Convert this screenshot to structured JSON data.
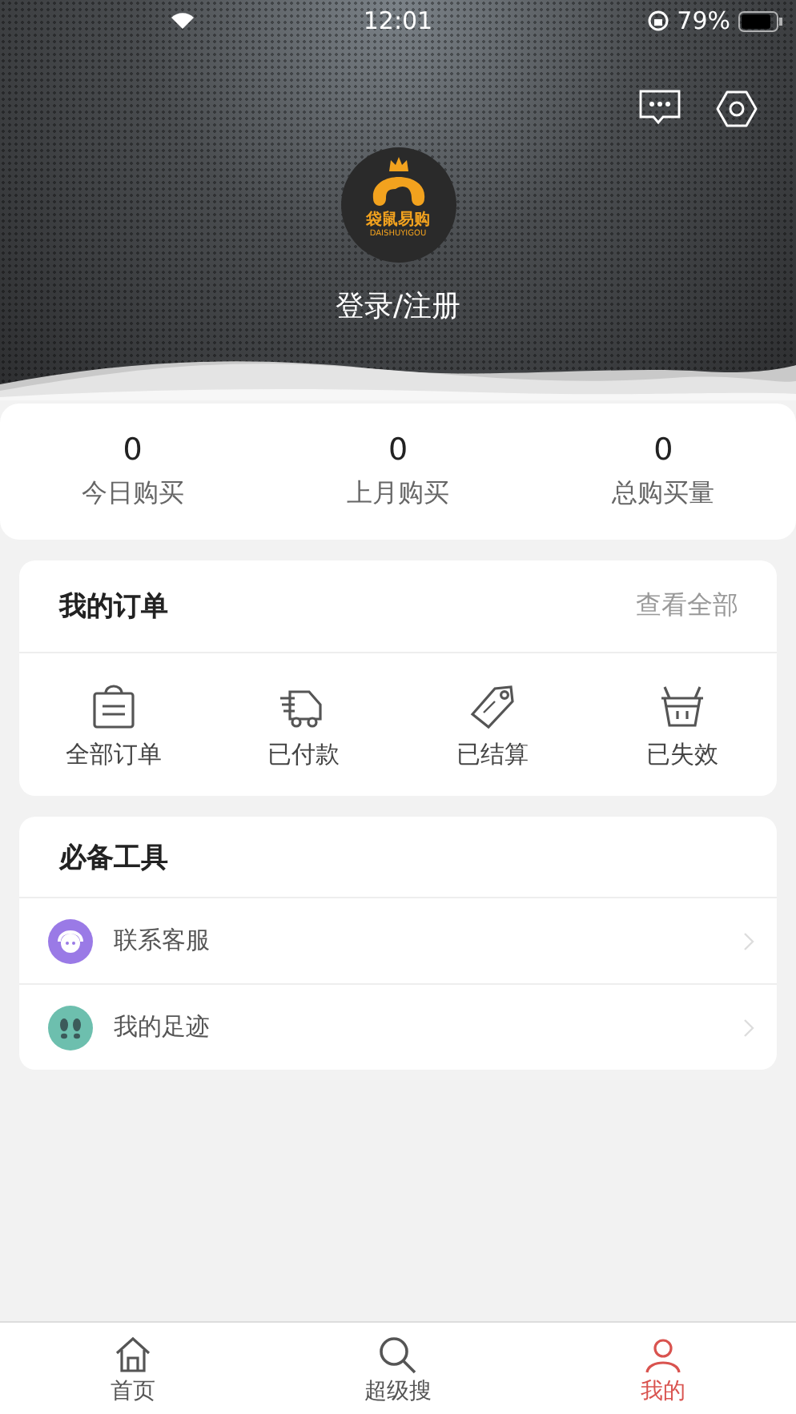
{
  "status_bar": {
    "time": "12:01",
    "battery": "79%"
  },
  "header": {
    "logo": {
      "name": "袋鼠易购",
      "subtitle": "DAISHUYIGOU"
    },
    "login": "登录/注册"
  },
  "stats": [
    {
      "value": "0",
      "label": "今日购买"
    },
    {
      "value": "0",
      "label": "上月购买"
    },
    {
      "value": "0",
      "label": "总购买量"
    }
  ],
  "orders": {
    "title": "我的订单",
    "view_all": "查看全部",
    "items": [
      {
        "kind": "bag",
        "label": "全部订单"
      },
      {
        "kind": "truck",
        "label": "已付款"
      },
      {
        "kind": "tag",
        "label": "已结算"
      },
      {
        "kind": "basket",
        "label": "已失效"
      }
    ]
  },
  "tools": {
    "title": "必备工具",
    "items": [
      {
        "kind": "service",
        "label": "联系客服"
      },
      {
        "kind": "footprints",
        "label": "我的足迹"
      }
    ]
  },
  "tab_bar": [
    {
      "kind": "home",
      "label": "首页",
      "selected": false
    },
    {
      "kind": "search",
      "label": "超级搜",
      "selected": false
    },
    {
      "kind": "profile",
      "label": "我的",
      "selected": true
    }
  ]
}
